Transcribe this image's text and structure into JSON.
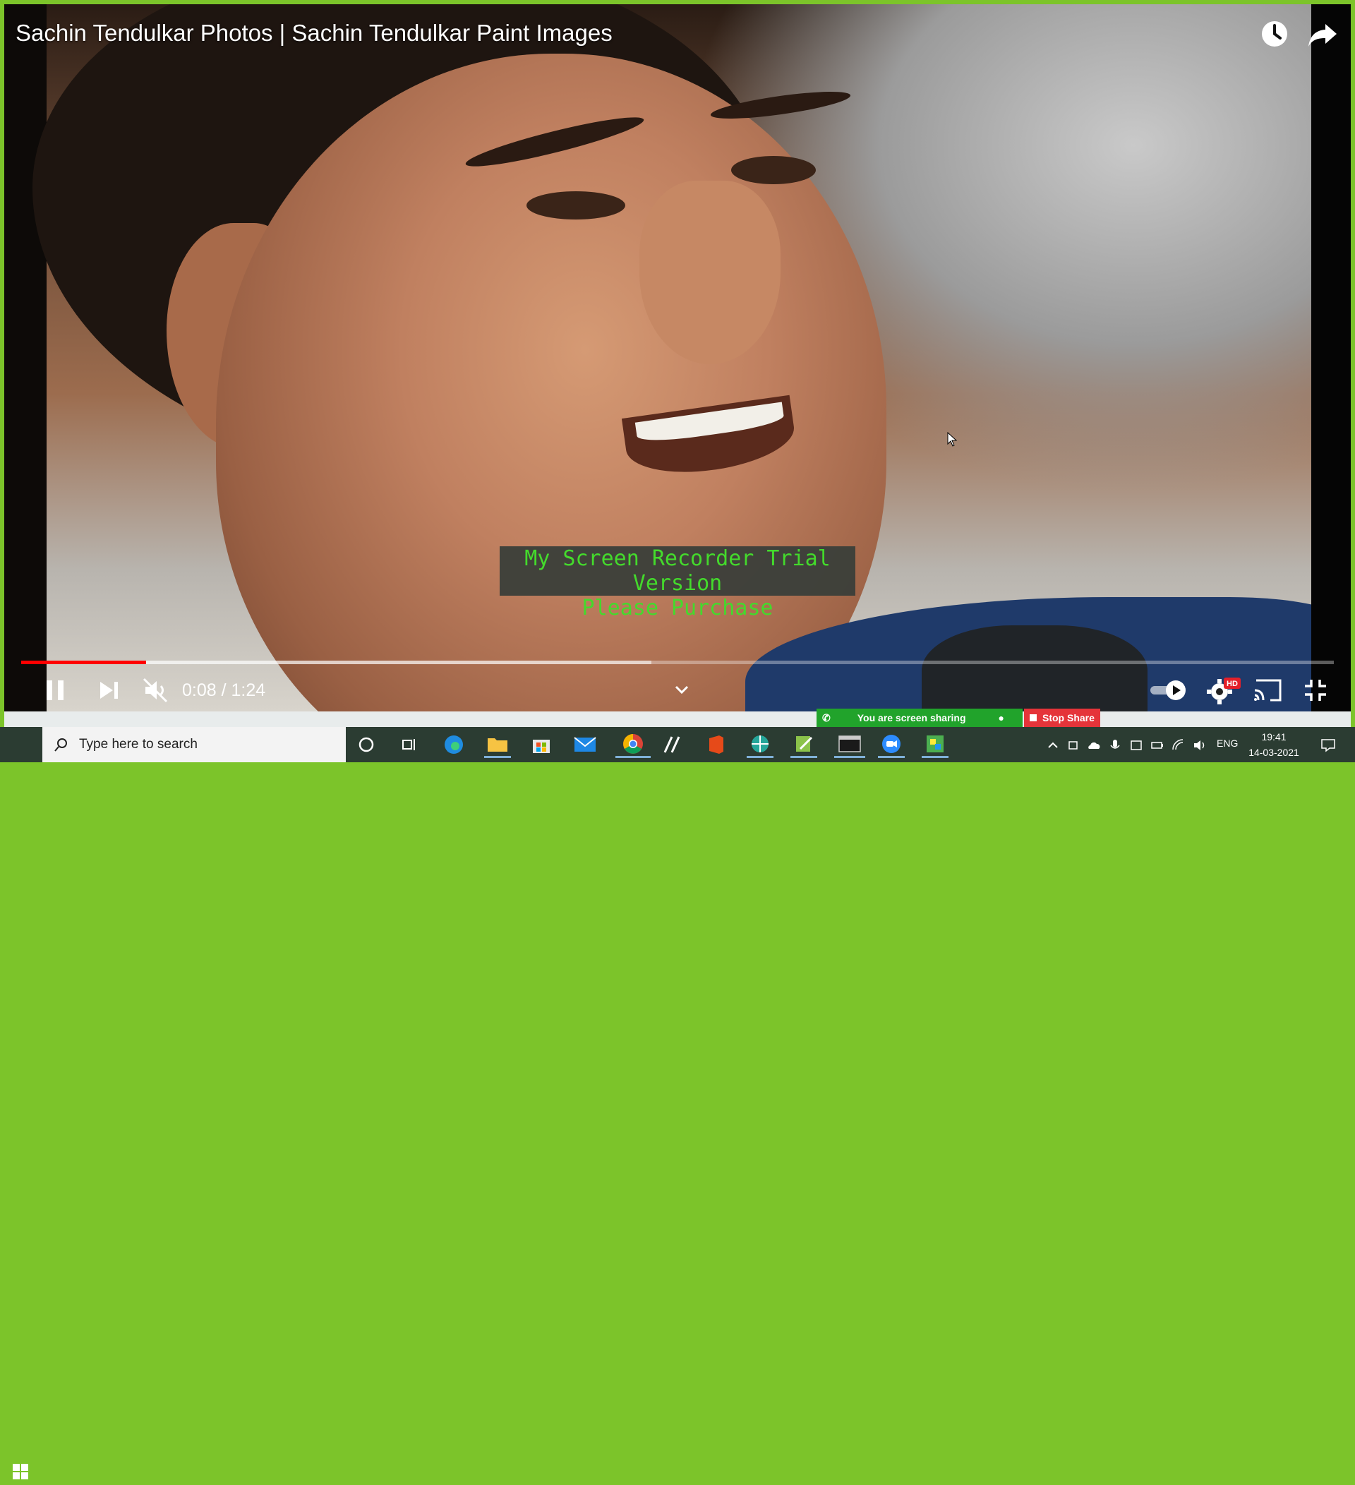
{
  "video": {
    "title": "Sachin Tendulkar Photos | Sachin Tendulkar Paint Images",
    "watch_later_icon": "clock-icon",
    "share_icon": "share-arrow-icon"
  },
  "watermark": {
    "line1": "My Screen Recorder Trial Version",
    "line2": "Please Purchase"
  },
  "player": {
    "current_time": "0:08",
    "duration": "1:24",
    "time_display": "0:08 / 1:24",
    "progress_fraction": 0.095,
    "buffer_fraction": 0.48,
    "controls": [
      "pause-icon",
      "next-icon",
      "mute-icon",
      "autoplay-toggle-icon",
      "settings-icon",
      "cast-icon",
      "exit-fullscreen-icon"
    ],
    "hd_badge": "HD"
  },
  "screen_share": {
    "status": "You are screen sharing",
    "stop_label": "Stop Share"
  },
  "taskbar": {
    "search_placeholder": "Type here to search",
    "apps": [
      "cortana",
      "task-view",
      "edge",
      "file-explorer",
      "store",
      "mail",
      "chrome",
      "app",
      "office",
      "app",
      "app",
      "terminal",
      "zoom",
      "app"
    ],
    "language": "ENG",
    "time": "19:41",
    "date": "14-03-2021"
  },
  "colors": {
    "frame": "#7cc42a",
    "progress": "#ff0000",
    "watermark_text": "#3ee02a",
    "sharing_green": "#21a32b",
    "stop_red": "#e5343a"
  }
}
